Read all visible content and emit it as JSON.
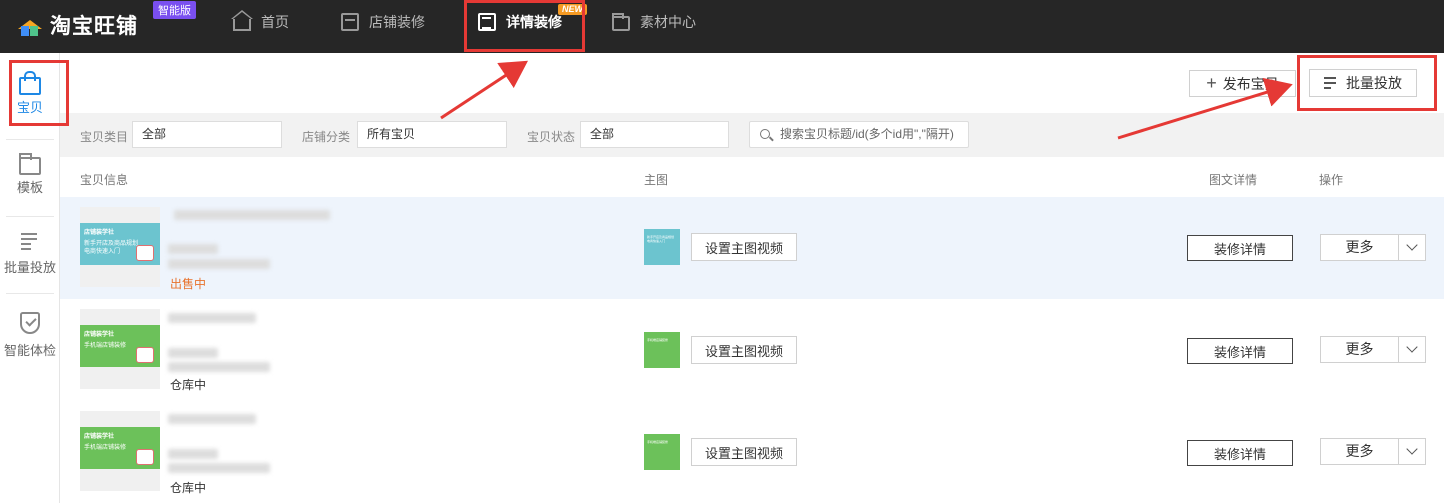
{
  "app": {
    "name": "淘宝旺铺",
    "edition_badge": "智能版"
  },
  "topnav": {
    "items": [
      {
        "label": "首页",
        "icon": "home-icon"
      },
      {
        "label": "店铺装修",
        "icon": "store-icon"
      },
      {
        "label": "详情装修",
        "icon": "detail-page-icon",
        "active": true,
        "badge": "NEW"
      },
      {
        "label": "素材中心",
        "icon": "folder-icon"
      }
    ]
  },
  "sidebar": {
    "items": [
      {
        "label": "宝贝",
        "icon": "bag-icon",
        "active": true
      },
      {
        "label": "模板",
        "icon": "folder-icon"
      },
      {
        "label": "批量投放",
        "icon": "batch-list-icon"
      },
      {
        "label": "智能体检",
        "icon": "shield-check-icon"
      }
    ]
  },
  "toolbar": {
    "publish_label": "发布宝贝",
    "batch_label": "批量投放"
  },
  "filters": {
    "category_label": "宝贝类目",
    "category_value": "全部",
    "shop_category_label": "店铺分类",
    "shop_category_value": "所有宝贝",
    "status_label": "宝贝状态",
    "status_value": "全部",
    "search_placeholder": "搜索宝贝标题/id(多个id用\",\"隔开)"
  },
  "table": {
    "headers": {
      "info": "宝贝信息",
      "main_image": "主图",
      "detail": "图文详情",
      "actions": "操作"
    },
    "rows": [
      {
        "status": "出售中",
        "status_color": "#e8722c",
        "thumb_brand": "店铺装学社",
        "thumb_title": "新手开店及商品规划 电商快速入门",
        "thumb_color": "#6cc4cf",
        "video_button": "设置主图视频",
        "decorate_button": "装修详情",
        "more_button": "更多"
      },
      {
        "status": "仓库中",
        "status_color": "#333333",
        "thumb_brand": "店铺装学社",
        "thumb_title": "手机端店铺装修",
        "thumb_color": "#6cc15a",
        "video_button": "设置主图视频",
        "decorate_button": "装修详情",
        "more_button": "更多"
      },
      {
        "status": "仓库中",
        "status_color": "#333333",
        "thumb_brand": "店铺装学社",
        "thumb_title": "手机端店铺装修",
        "thumb_color": "#6cc15a",
        "video_button": "设置主图视频",
        "decorate_button": "装修详情",
        "more_button": "更多"
      }
    ]
  },
  "colors": {
    "topbar": "#262626",
    "accent": "#1e88e5",
    "annotation": "#e53935",
    "row_highlight": "#eef4fc"
  }
}
